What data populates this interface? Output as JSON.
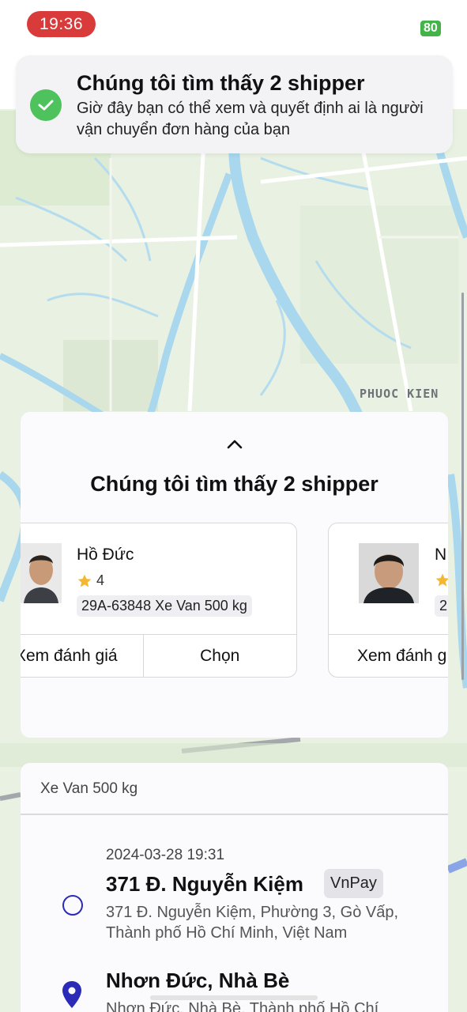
{
  "status_bar": {
    "time": "19:36",
    "battery": "80"
  },
  "banner": {
    "title": "Chúng tôi tìm thấy 2 shipper",
    "message": "Giờ đây bạn có thể xem và quyết định ai là người vận chuyển đơn hàng của bạn"
  },
  "map": {
    "place_label": "PHUOC KIEN"
  },
  "sheet": {
    "title": "Chúng tôi tìm thấy 2 shipper",
    "drivers": [
      {
        "name": "Hồ Đức",
        "rating": "4",
        "vehicle": "29A-63848 Xe Van 500 kg",
        "view_reviews_label": "Xem đánh giá",
        "choose_label": "Chọn"
      },
      {
        "name": "N",
        "rating": "",
        "vehicle": "2",
        "view_reviews_label": "Xem đánh g"
      }
    ]
  },
  "order": {
    "vehicle_type": "Xe Van 500 kg",
    "datetime": "2024-03-28 19:31",
    "pickup": {
      "title": "371 Đ. Nguyễn Kiệm",
      "payment": "VnPay",
      "address": "371 Đ. Nguyễn Kiệm, Phường 3, Gò Vấp, Thành phố Hồ Chí Minh, Việt Nam"
    },
    "dropoff": {
      "title": "Nhơn Đức, Nhà Bè",
      "address": "Nhơn Đức, Nhà Bè, Thành phố Hồ Chí"
    }
  },
  "colors": {
    "accent": "#2b2bb8",
    "success": "#4dc25d",
    "time_pill": "#d93a3a",
    "star": "#f5b731"
  }
}
